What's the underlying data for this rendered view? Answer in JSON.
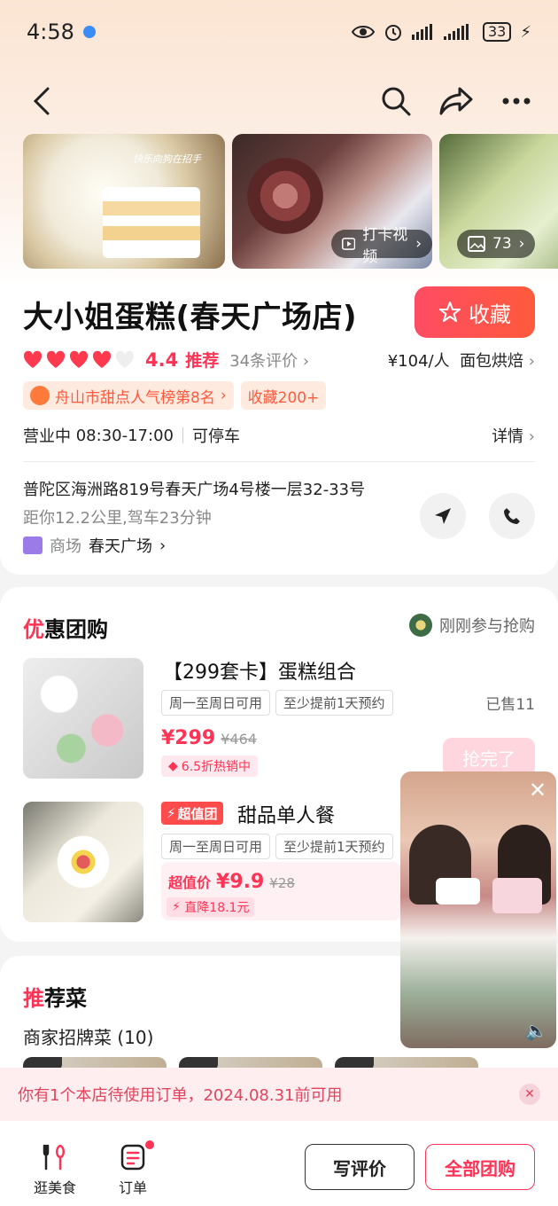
{
  "status": {
    "time": "4:58",
    "battery": "33"
  },
  "photos": {
    "video_chip": "打卡视频",
    "count_chip": "73",
    "photo1_caption": "快乐向狗在招手"
  },
  "shop": {
    "name": "大小姐蛋糕(春天广场店)",
    "fav_label": "收藏",
    "score": "4.4",
    "score_label": "推荐",
    "reviews": "34条评价",
    "price": "¥104/人",
    "category": "面包烘焙",
    "rank_tag": "舟山市甜点人气榜第8名",
    "fav_tag": "收藏200+",
    "status": "营业中",
    "hours": "08:30-17:00",
    "parking": "可停车",
    "detail": "详情",
    "address": "普陀区海洲路819号春天广场4号楼一层32-33号",
    "distance": "距你12.2公里,驾车23分钟",
    "mall_label": "商场",
    "mall_name": "春天广场"
  },
  "deals": {
    "title_first": "优",
    "title_rest": "惠团购",
    "recent": "刚刚参与抢购",
    "items": [
      {
        "name": "【299套卡】蛋糕组合",
        "cond1": "周一至周日可用",
        "cond2": "至少提前1天预约",
        "sold": "已售11",
        "price": "¥299",
        "old": "¥464",
        "discount": "6.5折热销中",
        "action": "抢完了"
      },
      {
        "badge": "超值团",
        "name": "甜品单人餐",
        "cond1": "周一至周日可用",
        "cond2": "至少提前1天预约",
        "value_label": "超值价",
        "price": "¥9.9",
        "old": "¥28",
        "drop": "直降18.1元"
      }
    ]
  },
  "recs": {
    "title_first": "推",
    "title_rest": "荐菜",
    "subtitle": "商家招牌菜 (10)"
  },
  "notice": {
    "text": "你有1个本店待使用订单，2024.08.31前可用"
  },
  "bottom": {
    "tab1": "逛美食",
    "tab2": "订单",
    "review": "写评价",
    "all": "全部团购"
  }
}
